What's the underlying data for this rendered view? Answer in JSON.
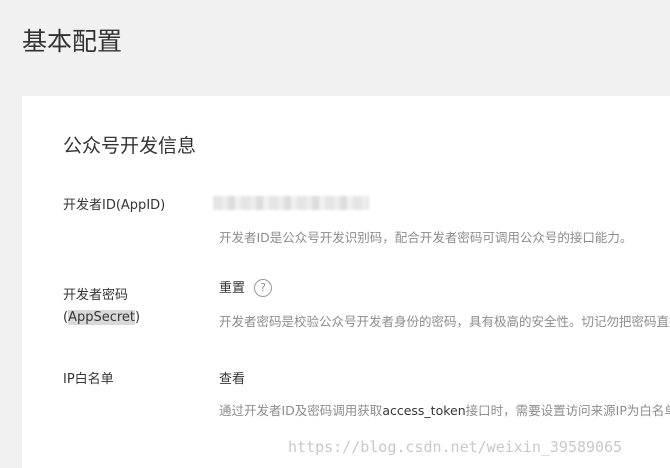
{
  "page": {
    "title": "基本配置"
  },
  "section": {
    "title": "公众号开发信息"
  },
  "rows": {
    "appid": {
      "label": "开发者ID(AppID)",
      "tip": "开发者ID是公众号开发识别码，配合开发者密码可调用公众号的接口能力。"
    },
    "secret": {
      "label_line1": "开发者密码",
      "label_line2_open": "(",
      "label_line2_highlight": "AppSecret",
      "label_line2_close": ")",
      "action": "重置",
      "help_symbol": "?",
      "tip": "开发者密码是校验公众号开发者身份的密码，具有极高的安全性。切记勿把密码直接交给第三方开发者或直接存储在代码中。"
    },
    "ip_whitelist": {
      "label": "IP白名单",
      "action": "查看",
      "tip_before": "通过开发者ID及密码调用获取",
      "tip_code": "access_token",
      "tip_after": "接口时，需要设置访问来源IP为白名单。"
    }
  },
  "watermark": "https://blog.csdn.net/weixin_39589065"
}
